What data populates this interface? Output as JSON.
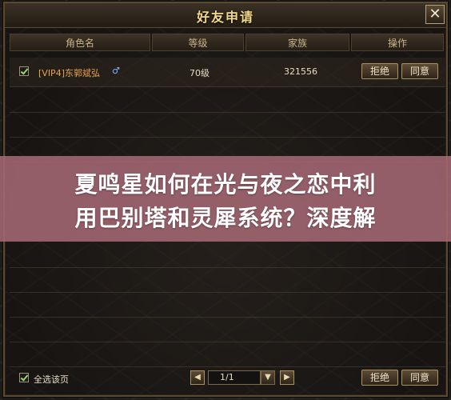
{
  "dialog": {
    "title": "好友申请",
    "close_icon": "close-icon",
    "columns": [
      "角色名",
      "等级",
      "家族",
      "操作"
    ],
    "rows": [
      {
        "checked": true,
        "name": "[VIP4]东郭斌弘",
        "gender_icon": "male-icon",
        "gender_symbol": "♂",
        "level": "70级",
        "family": "321556",
        "reject_label": "拒绝",
        "accept_label": "同意"
      }
    ],
    "footer": {
      "select_all_checked": true,
      "select_all_label": "全选该页",
      "page_text": "1/1",
      "prev_icon": "prev-page-icon",
      "next_icon": "next-page-icon",
      "dropdown_icon": "chevron-down-icon",
      "reject_label": "拒绝",
      "accept_label": "同意"
    }
  },
  "banner": {
    "line1": "夏鸣星如何在光与夜之恋中利",
    "line2": "用巴别塔和灵犀系统？深度解"
  }
}
